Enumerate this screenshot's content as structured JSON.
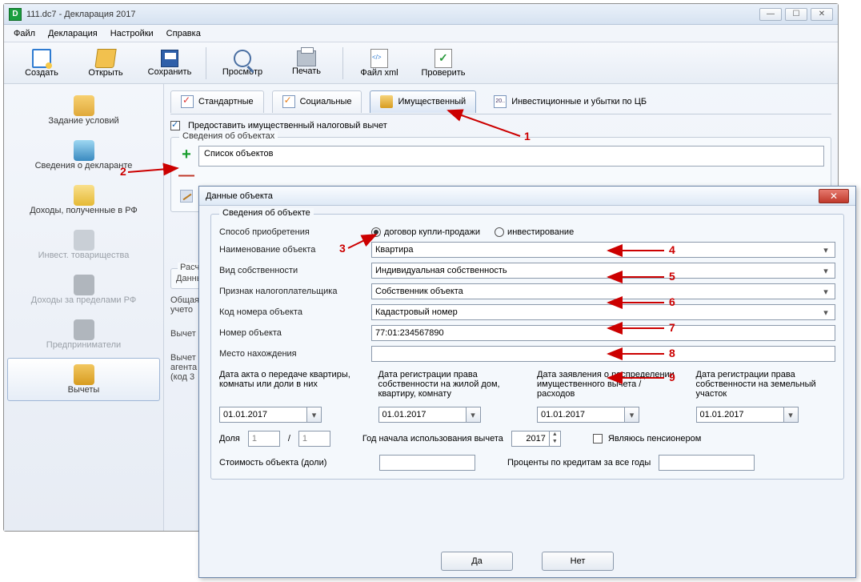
{
  "window": {
    "title": "111.dc7 - Декларация 2017"
  },
  "menu": {
    "file": "Файл",
    "declaration": "Декларация",
    "settings": "Настройки",
    "help": "Справка"
  },
  "toolbar": {
    "create": "Создать",
    "open": "Открыть",
    "save": "Сохранить",
    "view": "Просмотр",
    "print": "Печать",
    "xml": "Файл xml",
    "check": "Проверить"
  },
  "sidebar": {
    "s1": "Задание условий",
    "s2": "Сведения о декларанте",
    "s3": "Доходы, полученные в РФ",
    "s4": "Инвест. товарищества",
    "s5": "Доходы за пределами РФ",
    "s6": "Предприниматели",
    "s7": "Вычеты"
  },
  "tabs": {
    "standard": "Стандартные",
    "social": "Социальные",
    "property": "Имущественный",
    "invest": "Инвестиционные и убытки по ЦБ",
    "invest_ic": "20.."
  },
  "pane": {
    "chk_provide": "Предоставить имущественный налоговый вычет",
    "group_objects": "Сведения об объектах",
    "list_caption": "Список объектов",
    "group_calc": "Расчет",
    "row_a": "Данные",
    "row_b1": "Общая",
    "row_b2": "учето",
    "row_c": "Вычет",
    "row_d1": "Вычет",
    "row_d2": "агента",
    "row_d3": "(код 3"
  },
  "dialog": {
    "title": "Данные объекта",
    "legend": "Сведения об объекте",
    "acq_label": "Способ приобретения",
    "acq_opt1": "договор купли-продажи",
    "acq_opt2": "инвестирование",
    "name_label": "Наименование объекта",
    "name_value": "Квартира",
    "own_label": "Вид собственности",
    "own_value": "Индивидуальная собственность",
    "taxp_label": "Признак налогоплательщика",
    "taxp_value": "Собственник объекта",
    "code_label": "Код номера объекта",
    "code_value": "Кадастровый номер",
    "num_label": "Номер объекта",
    "num_value": "77:01:234567890",
    "loc_label": "Место нахождения",
    "loc_value": "",
    "date1_cap": "Дата акта о передаче квартиры, комнаты или доли в них",
    "date2_cap": "Дата регистрации права собственности на жилой дом, квартиру, комнату",
    "date3_cap": "Дата заявления о распределении имущественного вычета / расходов",
    "date4_cap": "Дата регистрации права собственности на земельный участок",
    "date_val": "01.01.2017",
    "share_label": "Доля",
    "share_a": "1",
    "share_b": "1",
    "year_label": "Год начала использования вычета",
    "year_value": "2017",
    "pension_label": "Являюсь пенсионером",
    "cost_label": "Стоимость объекта (доли)",
    "interest_label": "Проценты по кредитам за все годы",
    "ok": "Да",
    "cancel": "Нет"
  },
  "annot": {
    "n1": "1",
    "n2": "2",
    "n3": "3",
    "n4": "4",
    "n5": "5",
    "n6": "6",
    "n7": "7",
    "n8": "8",
    "n9": "9"
  }
}
